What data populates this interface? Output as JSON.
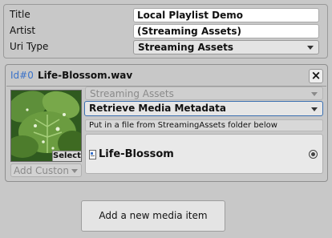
{
  "header": {
    "title_label": "Title",
    "title_value": "Local Playlist Demo",
    "artist_label": "Artist",
    "artist_value": "(Streaming Assets)",
    "uri_type_label": "Uri Type",
    "uri_type_value": "Streaming Assets"
  },
  "item": {
    "id_label": "Id#0",
    "file_name": "Life-Blossom.wav",
    "close_glyph": "×",
    "select_label": "Select",
    "add_custom_label": "Add Custon",
    "source_type_value": "Streaming Assets",
    "metadata_action_value": "Retrieve Media Metadata",
    "hint_text": "Put in a file from StreamingAssets folder below",
    "asset_name": "Life-Blossom"
  },
  "footer": {
    "add_item_label": "Add a new media item"
  },
  "colors": {
    "background": "#c8c8c8",
    "id_accent": "#3a72c9",
    "focus_border": "#3a6fb0"
  },
  "icons": {
    "close": "close-icon",
    "dropdown": "chevron-down-icon",
    "asset": "audio-file-icon",
    "object_picker": "object-picker-icon"
  }
}
